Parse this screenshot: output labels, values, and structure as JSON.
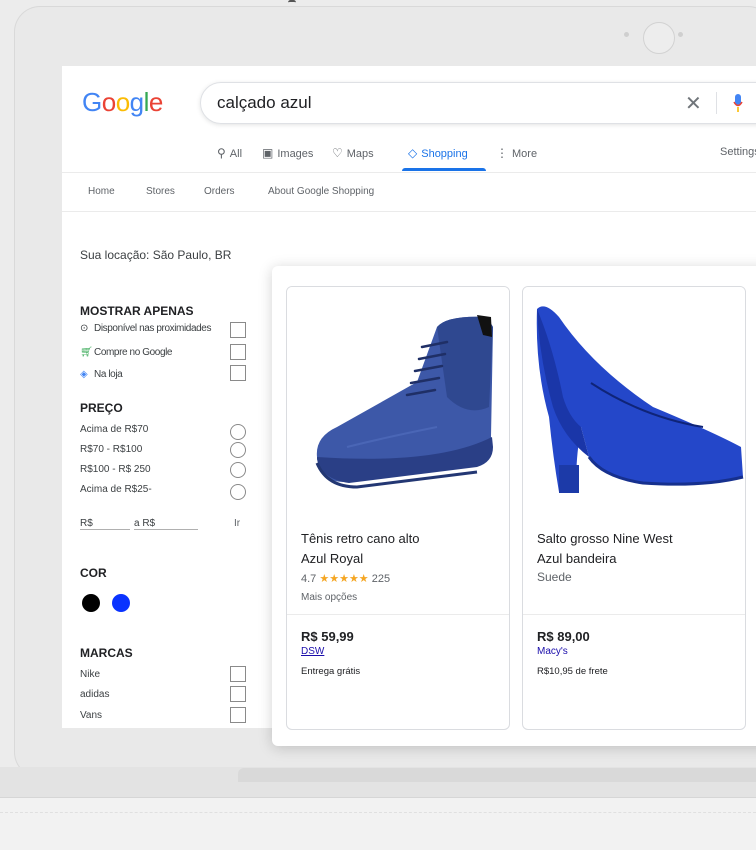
{
  "search": {
    "query": "calçado azul"
  },
  "logo_letters": [
    {
      "ch": "G",
      "color": "#4285F4"
    },
    {
      "ch": "o",
      "color": "#EA4335"
    },
    {
      "ch": "o",
      "color": "#FBBC05"
    },
    {
      "ch": "g",
      "color": "#4285F4"
    },
    {
      "ch": "l",
      "color": "#34A853"
    },
    {
      "ch": "e",
      "color": "#EA4335"
    }
  ],
  "tabs": {
    "all": "All",
    "images": "Images",
    "maps": "Maps",
    "shopping": "Shopping",
    "more": "More",
    "settings": "Settings"
  },
  "subnav": {
    "home": "Home",
    "stores": "Stores",
    "orders": "Orders",
    "about": "About Google Shopping"
  },
  "location": "Sua locação: São Paulo, BR",
  "filters": {
    "show_only": {
      "heading": "MOSTRAR APENAS",
      "items": [
        "Disponível nas proximidades",
        "Compre no Google",
        "Na loja"
      ]
    },
    "price": {
      "heading": "PREÇO",
      "items": [
        "Acima de R$70",
        "R$70 - R$100",
        "R$100 - R$ 250",
        "Acima de R$25-"
      ],
      "min_label": "R$",
      "max_label": "a R$",
      "go": "Ir"
    },
    "color": {
      "heading": "COR",
      "swatches": [
        "#000000",
        "#0a33ff"
      ]
    },
    "brands": {
      "heading": "MARCAS",
      "items": [
        "Nike",
        "adidas",
        "Vans"
      ]
    }
  },
  "products": [
    {
      "title_line1": "Tênis retro cano alto",
      "title_line2": "Azul Royal",
      "rating": "4.7",
      "stars": "★★★★★",
      "reviews": "225",
      "options": "Mais opções",
      "price": "R$ 59,99",
      "store": "DSW",
      "shipping": "Entrega grátis"
    },
    {
      "title_line1": "Salto grosso Nine West",
      "title_line2": "Azul bandeira",
      "subtitle": "Suede",
      "price": "R$ 89,00",
      "store": "Macy's",
      "shipping": "R$10,95 de frete"
    }
  ]
}
